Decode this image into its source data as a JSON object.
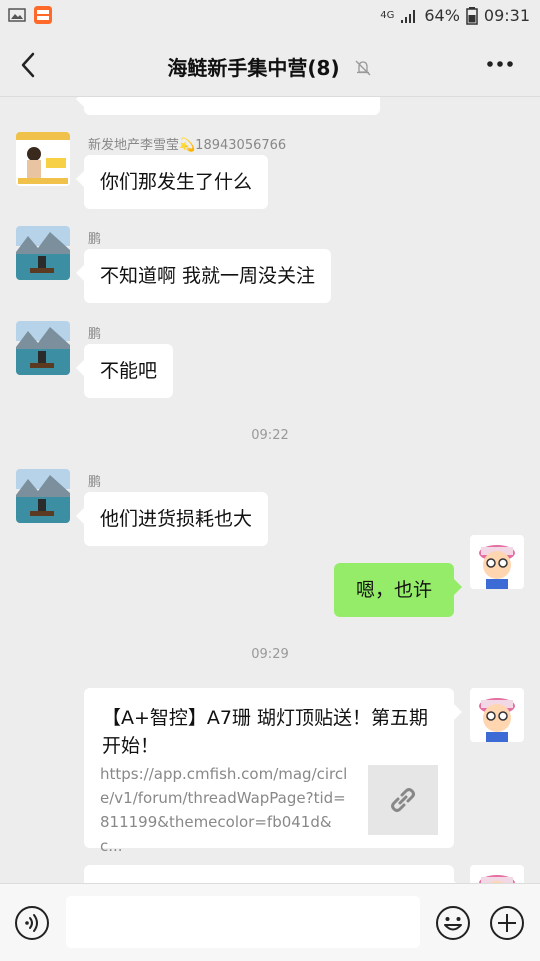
{
  "status_bar": {
    "network": "4G",
    "battery": "64%",
    "time": "09:31"
  },
  "header": {
    "title": "海鲢新手集中营(8)",
    "back_icon": "chevron-left-icon",
    "mute_icon": "bell-off-icon",
    "more_icon": "more-dots-icon"
  },
  "messages": [
    {
      "side": "left",
      "sender": "新发地产李雪莹💫18943056766",
      "text": "你们那发生了什么"
    },
    {
      "side": "left",
      "sender": "鹏",
      "text": "不知道啊 我就一周没关注"
    },
    {
      "side": "left",
      "sender": "鹏",
      "text": "不能吧"
    },
    {
      "time": "09:22"
    },
    {
      "side": "left",
      "sender": "鹏",
      "text": "他们进货损耗也大"
    },
    {
      "side": "right",
      "text": "嗯，也许"
    },
    {
      "time": "09:29"
    },
    {
      "side": "right",
      "card": {
        "title": "【A+智控】A7珊 瑚灯顶贴送！第五期开始！",
        "url": "https://app.cmfish.com/mag/circle/v1/forum/threadWapPage?tid=811199&themecolor=fb041d&c...",
        "icon": "link-icon"
      }
    }
  ],
  "bottom": {
    "voice_icon": "voice-icon",
    "emoji_icon": "emoji-icon",
    "plus_icon": "plus-icon",
    "input_placeholder": ""
  },
  "colors": {
    "background": "#ededed",
    "bubble_in": "#ffffff",
    "bubble_out": "#95ec69",
    "time_text": "#999999"
  }
}
